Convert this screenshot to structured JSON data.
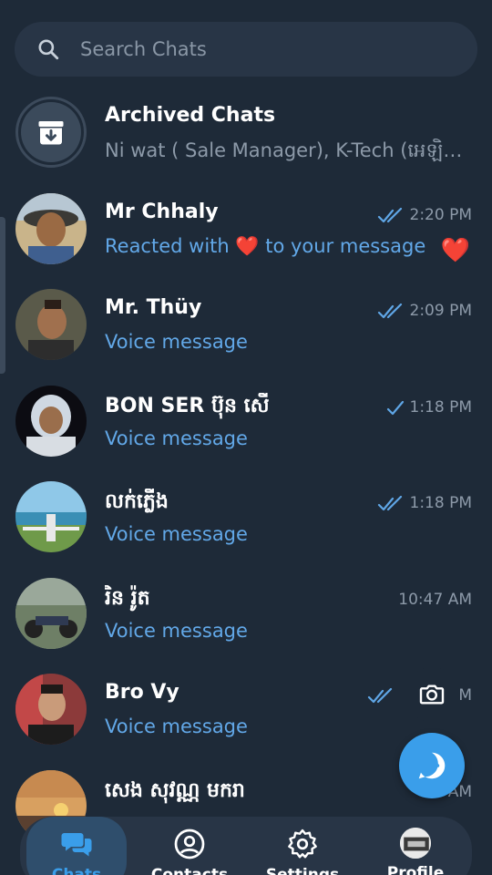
{
  "search": {
    "placeholder": "Search Chats"
  },
  "archived": {
    "title": "Archived Chats",
    "preview": "Ni wat ( Sale Manager), K-Tech (អេឡិចត្រូ..."
  },
  "chats": [
    {
      "name": "Mr Chhaly",
      "preview_before": "Reacted with ",
      "preview_emoji": "❤️",
      "preview_after": " to your message",
      "time": "2:20 PM",
      "status": "read",
      "reaction": "❤️"
    },
    {
      "name": "Mr. Thüy",
      "preview": "Voice message",
      "time": "2:09 PM",
      "status": "read"
    },
    {
      "name": "BON SER ប៊ុន សើ",
      "preview": "Voice message",
      "time": "1:18 PM",
      "status": "sent"
    },
    {
      "name": "លក់ភ្លើង",
      "preview": "Voice message",
      "time": "1:18 PM",
      "status": "read"
    },
    {
      "name": "រិន រ៉ូត",
      "preview": "Voice message",
      "time": "10:47 AM",
      "status": "none"
    },
    {
      "name": "Bro Vy",
      "preview": "Voice message",
      "time": "1 M",
      "status": "read"
    },
    {
      "name": "សេង សុវណ្ណ មករា",
      "preview": "",
      "time": "AM",
      "status": "none"
    }
  ],
  "nav": {
    "chats": "Chats",
    "contacts": "Contacts",
    "settings": "Settings",
    "profile": "Profile"
  },
  "colors": {
    "background": "#1e2a38",
    "surface": "#283546",
    "accent": "#3a9eea",
    "preview_blue": "#62a8e8",
    "muted": "#8d9aa9",
    "heart": "#e5484d"
  }
}
